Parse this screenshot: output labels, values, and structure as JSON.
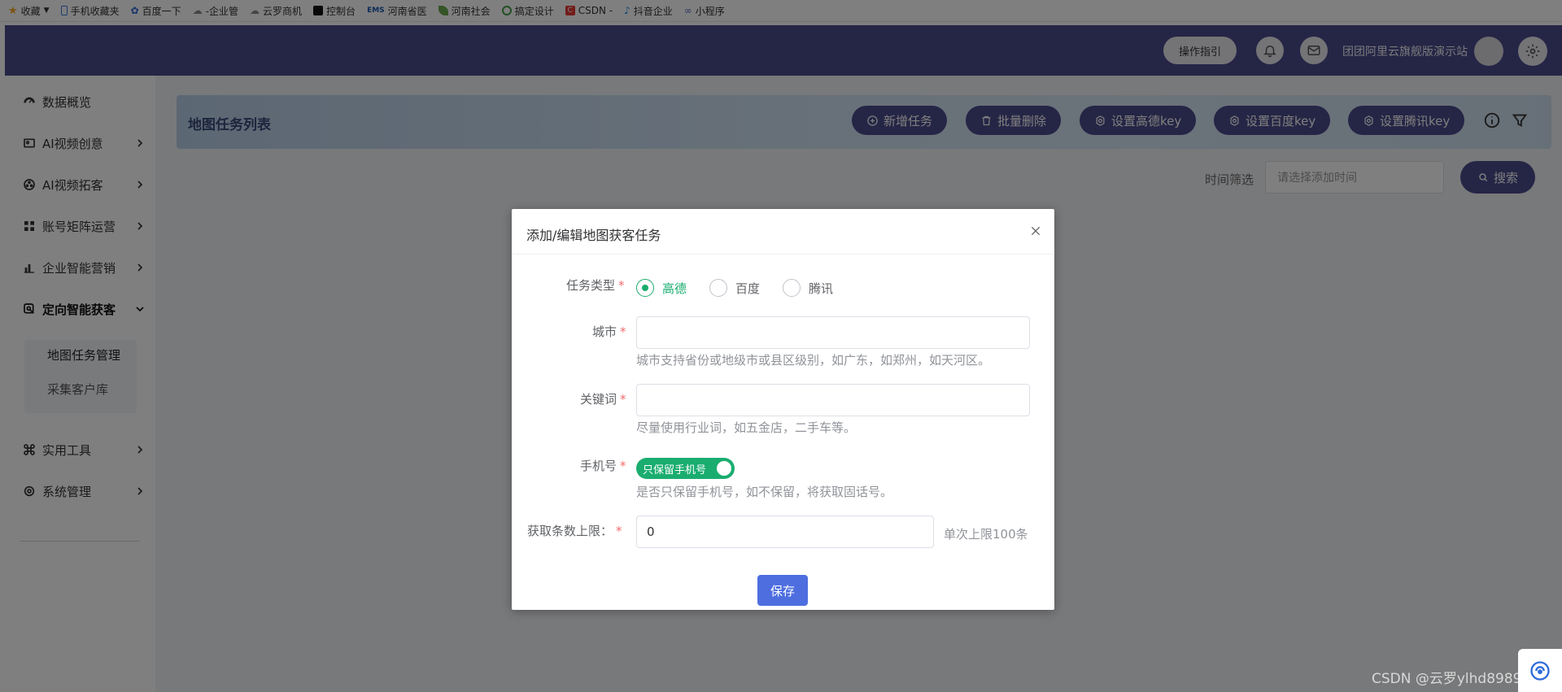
{
  "bookmarks": [
    {
      "label": "收藏",
      "icon": "star-icon",
      "color": "#f5a623"
    },
    {
      "label": "手机收藏夹",
      "icon": "phone-icon",
      "color": "#3b7bd8"
    },
    {
      "label": "百度一下",
      "icon": "baidu-icon",
      "color": "#2d64d8"
    },
    {
      "label": "-企业管",
      "icon": "cloud-icon",
      "color": "#888888"
    },
    {
      "label": "云罗商机",
      "icon": "cloud-icon",
      "color": "#888888"
    },
    {
      "label": "控制台",
      "icon": "tiktok-icon",
      "color": "#111111"
    },
    {
      "label": "河南省医",
      "icon": "ems-icon",
      "color": "#1a56b0"
    },
    {
      "label": "河南社会",
      "icon": "leaf-icon",
      "color": "#6aa84f"
    },
    {
      "label": "搞定设计",
      "icon": "ring-icon",
      "color": "#43a047"
    },
    {
      "label": "CSDN -",
      "icon": "csdn-icon",
      "color": "#e53935"
    },
    {
      "label": "抖音企业",
      "icon": "douyin-icon",
      "color": "#1e88e5"
    },
    {
      "label": "小程序",
      "icon": "mini-program-icon",
      "color": "#5c6bc0"
    }
  ],
  "topbar": {
    "guide_label": "操作指引",
    "site_name": "团团阿里云旗舰版演示站"
  },
  "sidebar": {
    "items": [
      {
        "label": "数据概览",
        "icon": "dashboard-icon",
        "has_arrow": false
      },
      {
        "label": "AI视频创意",
        "icon": "video-icon",
        "has_arrow": true
      },
      {
        "label": "AI视频拓客",
        "icon": "film-reel-icon",
        "has_arrow": true
      },
      {
        "label": "账号矩阵运营",
        "icon": "grid-icon",
        "has_arrow": true
      },
      {
        "label": "企业智能营销",
        "icon": "bar-chart-icon",
        "has_arrow": true
      },
      {
        "label": "定向智能获客",
        "icon": "target-icon",
        "has_arrow": true,
        "expanded": true
      },
      {
        "label": "实用工具",
        "icon": "command-icon",
        "has_arrow": true
      },
      {
        "label": "系统管理",
        "icon": "gear-icon",
        "has_arrow": true
      }
    ],
    "subitems": [
      {
        "label": "地图任务管理",
        "active": true
      },
      {
        "label": "采集客户库",
        "active": false
      }
    ]
  },
  "main": {
    "title": "地图任务列表",
    "buttons": [
      {
        "label": "新增任务",
        "icon": "plus-circle-icon"
      },
      {
        "label": "批量删除",
        "icon": "trash-icon"
      },
      {
        "label": "设置高德key",
        "icon": "gear-icon"
      },
      {
        "label": "设置百度key",
        "icon": "gear-icon"
      },
      {
        "label": "设置腾讯key",
        "icon": "gear-icon"
      }
    ],
    "filter_label": "时间筛选",
    "filter_placeholder": "请选择添加时间",
    "search_label": "搜索"
  },
  "dialog": {
    "title": "添加/编辑地图获客任务",
    "task_type_label": "任务类型",
    "task_type_options": [
      "高德",
      "百度",
      "腾讯"
    ],
    "task_type_selected": "高德",
    "city_label": "城市",
    "city_value": "",
    "city_hint": "城市支持省份或地级市或县区级别，如广东，如郑州，如天河区。",
    "keyword_label": "关键词",
    "keyword_value": "",
    "keyword_hint": "尽量使用行业词，如五金店，二手车等。",
    "phone_label": "手机号",
    "phone_switch_label": "只保留手机号",
    "phone_switch_on": true,
    "phone_hint": "是否只保留手机号，如不保留，将获取固话号。",
    "limit_label": "获取条数上限：",
    "limit_value": "0",
    "limit_hint": "单次上限100条",
    "save_label": "保存"
  },
  "watermark": "CSDN @云罗ylhd8989"
}
